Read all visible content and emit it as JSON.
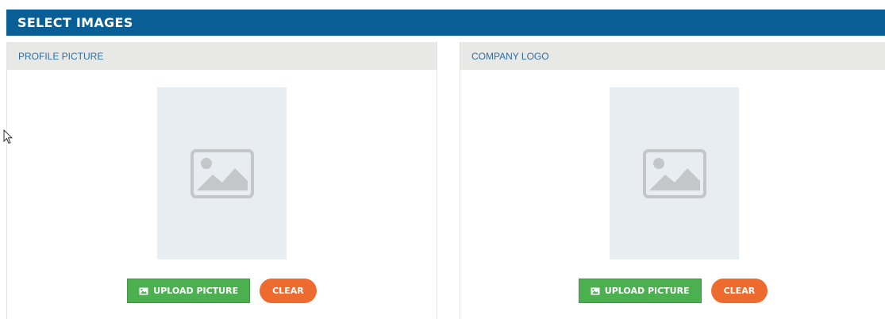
{
  "header": {
    "title": "SELECT IMAGES"
  },
  "panels": [
    {
      "title": "PROFILE PICTURE",
      "upload_label": "UPLOAD PICTURE",
      "clear_label": "CLEAR",
      "placeholder_icon": "image-placeholder-icon"
    },
    {
      "title": "COMPANY LOGO",
      "upload_label": "UPLOAD PICTURE",
      "clear_label": "CLEAR",
      "placeholder_icon": "image-placeholder-icon"
    }
  ],
  "colors": {
    "header_bg": "#0a5e96",
    "upload_button": "#4caf50",
    "clear_button": "#ee6b2f",
    "panel_title": "#2d6fa5"
  }
}
